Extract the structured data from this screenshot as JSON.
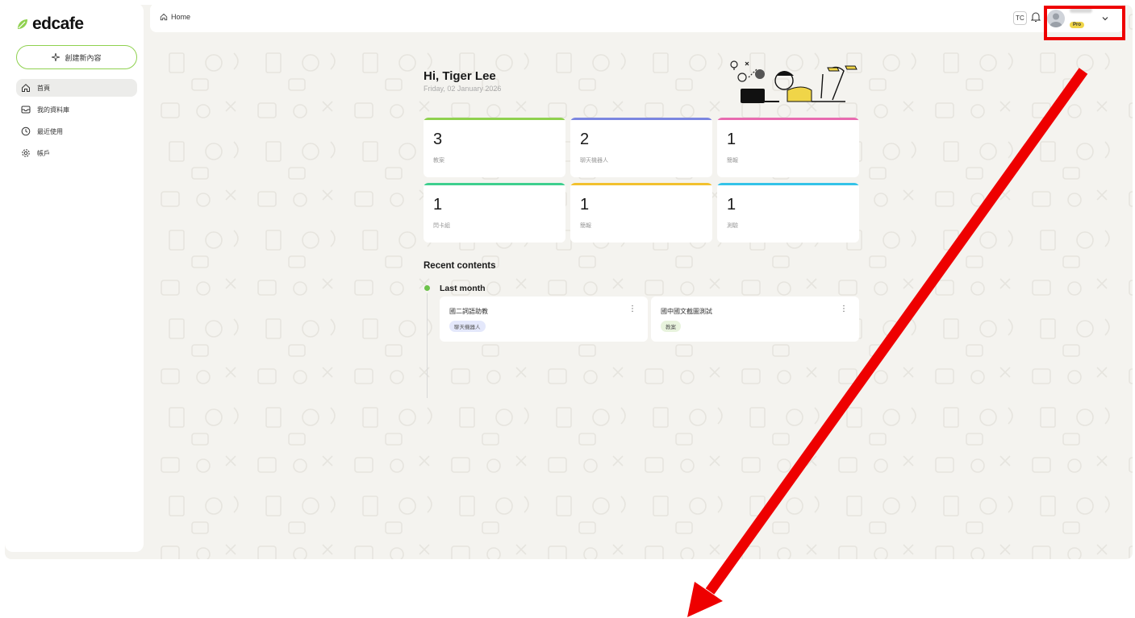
{
  "brand": {
    "name": "edcafe",
    "accent": "#8fd14f"
  },
  "sidebar": {
    "create_label": "創建新內容",
    "items": [
      {
        "label": "首頁",
        "icon": "home-icon",
        "active": true
      },
      {
        "label": "我的資料庫",
        "icon": "inbox-icon",
        "active": false
      },
      {
        "label": "最近使用",
        "icon": "clock-icon",
        "active": false
      },
      {
        "label": "帳戶",
        "icon": "gear-icon",
        "active": false
      }
    ]
  },
  "topbar": {
    "breadcrumb": "Home",
    "language": "TC",
    "plan_badge": "Pro"
  },
  "greeting": {
    "title": "Hi, Tiger Lee",
    "date": "Friday, 02 January 2026"
  },
  "stats": [
    {
      "count": "3",
      "label": "教案",
      "color": "#8fd14f"
    },
    {
      "count": "2",
      "label": "聊天機器人",
      "color": "#7b86e0"
    },
    {
      "count": "1",
      "label": "簡報",
      "color": "#e86bb0"
    },
    {
      "count": "1",
      "label": "閃卡組",
      "color": "#3ecf8e"
    },
    {
      "count": "1",
      "label": "簡報",
      "color": "#f2c12e"
    },
    {
      "count": "1",
      "label": "測驗",
      "color": "#34c3e8"
    }
  ],
  "recent": {
    "title": "Recent contents",
    "groups": [
      {
        "label": "Last month",
        "items": [
          {
            "title": "國二詞語助教",
            "tag": "聊天機器人",
            "tag_bg": "#e4e8fb"
          },
          {
            "title": "國中國文截圖測試",
            "tag": "教案",
            "tag_bg": "#e8f3dd"
          }
        ]
      }
    ]
  },
  "annotation": {
    "highlight_color": "#ee0000"
  }
}
